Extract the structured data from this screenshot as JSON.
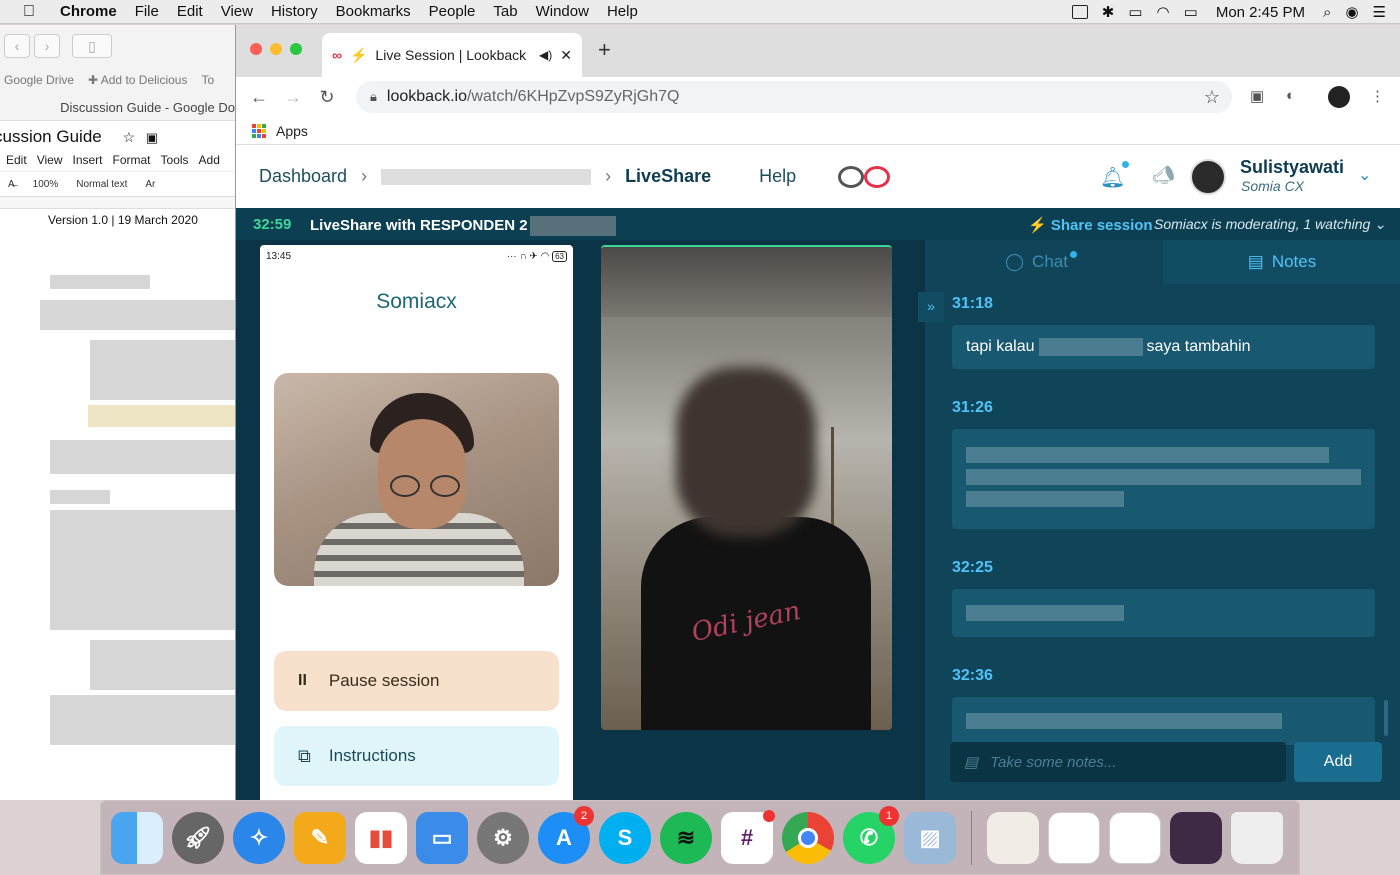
{
  "menubar": {
    "app": "Chrome",
    "items": [
      "File",
      "Edit",
      "View",
      "History",
      "Bookmarks",
      "People",
      "Tab",
      "Window",
      "Help"
    ],
    "clock": "Mon 2:45 PM"
  },
  "bg_window": {
    "bookmarks": [
      "Google Drive",
      "✚ Add to Delicious",
      "To"
    ],
    "tab_title": "Discussion Guide - Google Do",
    "doc_title": "cussion Guide",
    "menu": [
      "Edit",
      "View",
      "Insert",
      "Format",
      "Tools",
      "Add"
    ],
    "zoom": "100%",
    "style": "Normal text",
    "font": "Ar",
    "version": "Version 1.0 | 19 March 2020"
  },
  "browser": {
    "tab_title": "Live Session | Lookback",
    "url_domain": "lookback.io",
    "url_path": "/watch/6KHpZvpS9ZyRjGh7Q",
    "apps_label": "Apps"
  },
  "header": {
    "dashboard": "Dashboard",
    "liveshare": "LiveShare",
    "help": "Help",
    "user_name": "Sulistyawati",
    "user_org": "Somia CX"
  },
  "session": {
    "timer": "32:59",
    "title": "LiveShare with RESPONDEN 2",
    "share_label": "Share session",
    "moderating": "Somiacx is moderating, 1 watching"
  },
  "phone": {
    "time": "13:45",
    "battery": "63",
    "brand": "Somiacx",
    "pause_label": "Pause session",
    "instructions_label": "Instructions"
  },
  "camera": {
    "shirt_text": "Odi jean"
  },
  "panel": {
    "chat_tab": "Chat",
    "notes_tab": "Notes",
    "notes": [
      {
        "time": "31:18",
        "text_before": "tapi kalau",
        "text_after": "saya tambahin"
      },
      {
        "time": "31:26"
      },
      {
        "time": "32:25"
      },
      {
        "time": "32:36"
      }
    ],
    "input_placeholder": "Take some notes...",
    "add_label": "Add"
  },
  "dock": {
    "badges": {
      "appstore": "2",
      "whatsapp": "1"
    },
    "colors": {
      "accent": "#4fc3f7",
      "timer": "#3fd49a",
      "brand": "#e8304b",
      "dark_bg": "#0d3f52"
    }
  }
}
